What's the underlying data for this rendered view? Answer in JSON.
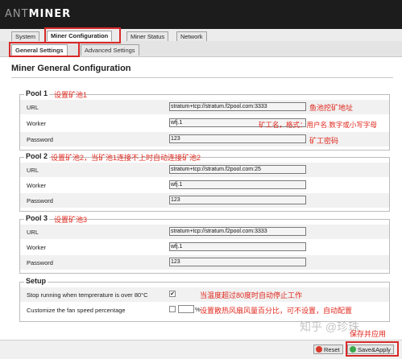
{
  "brand": {
    "prefix": "ANT",
    "suffix": "MINER"
  },
  "tabs": [
    {
      "label": "System"
    },
    {
      "label": "Miner Configuration"
    },
    {
      "label": "Miner Status"
    },
    {
      "label": "Network"
    }
  ],
  "subtabs": [
    {
      "label": "General Settings"
    },
    {
      "label": "Advanced Settings"
    }
  ],
  "page_title": "Miner General Configuration",
  "pools": [
    {
      "title": "Pool 1",
      "note": "设置矿池1",
      "url_label": "URL",
      "url": "stratum+tcp://stratum.f2pool.com:3333",
      "worker_label": "Worker",
      "worker": "wfj.1",
      "password_label": "Password",
      "password": "123"
    },
    {
      "title": "Pool 2",
      "note": "设置矿池2，当矿池1连接不上时自动连接矿池2",
      "url_label": "URL",
      "url": "stratum+tcp://stratum.f2pool.com:25",
      "worker_label": "Worker",
      "worker": "wfj.1",
      "password_label": "Password",
      "password": "123"
    },
    {
      "title": "Pool 3",
      "note": "设置矿池3",
      "url_label": "URL",
      "url": "stratum+tcp://stratum.f2pool.com:3333",
      "worker_label": "Worker",
      "worker": "wfj.1",
      "password_label": "Password",
      "password": "123"
    }
  ],
  "pool1_annotations": {
    "url": "鱼池挖矿地址",
    "worker": "矿工名，格式：用户名.数字或小写字母",
    "password": "矿工密码"
  },
  "setup": {
    "title": "Setup",
    "temp_label": "Stop running when temprerature is over 80°C",
    "temp_checked": true,
    "temp_note": "当温度超过80度时自动停止工作",
    "fan_label": "Customize the fan speed percentage",
    "fan_checked": false,
    "fan_suffix": "%",
    "fan_note": "设置散热风扇风量百分比，可不设置，自动配置"
  },
  "footer": {
    "save_note": "保存并应用",
    "reset_label": "Reset",
    "save_label": "Save&Apply"
  },
  "watermark": "知乎 @珍珠",
  "colors": {
    "annotation_red": "#e0281e",
    "header_bg": "#1c1c1c",
    "highlight_box": "#d82828"
  }
}
